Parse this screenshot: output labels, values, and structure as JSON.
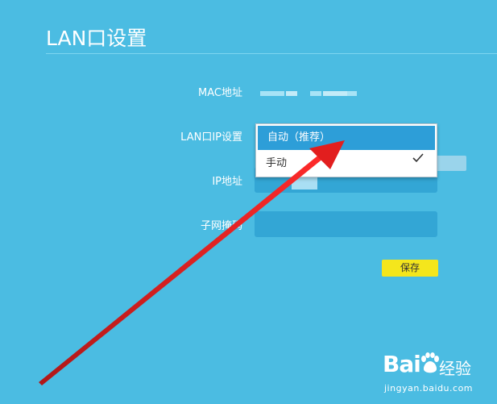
{
  "page": {
    "title": "LAN口设置"
  },
  "form": {
    "mac_label": "MAC地址",
    "lan_ip_label": "LAN口IP设置",
    "ip_label": "IP地址",
    "mask_label": "子网掩码",
    "save_label": "保存"
  },
  "dropdown": {
    "options": [
      {
        "label": "自动（推荐）",
        "selected": true
      },
      {
        "label": "手动",
        "selected": false
      }
    ]
  },
  "watermark": {
    "brand": "Bai",
    "brand_suffix": "经验",
    "url": "jingyan.baidu.com"
  },
  "colors": {
    "background": "#4bbce2",
    "field": "#33a6d5",
    "selected_option": "#2d9ed8",
    "save_button": "#f4e61c",
    "arrow": "#e02020"
  },
  "icons": {
    "check": "checkmark-icon",
    "arrow": "red-arrow-annotation",
    "paw": "baidu-paw-icon"
  }
}
